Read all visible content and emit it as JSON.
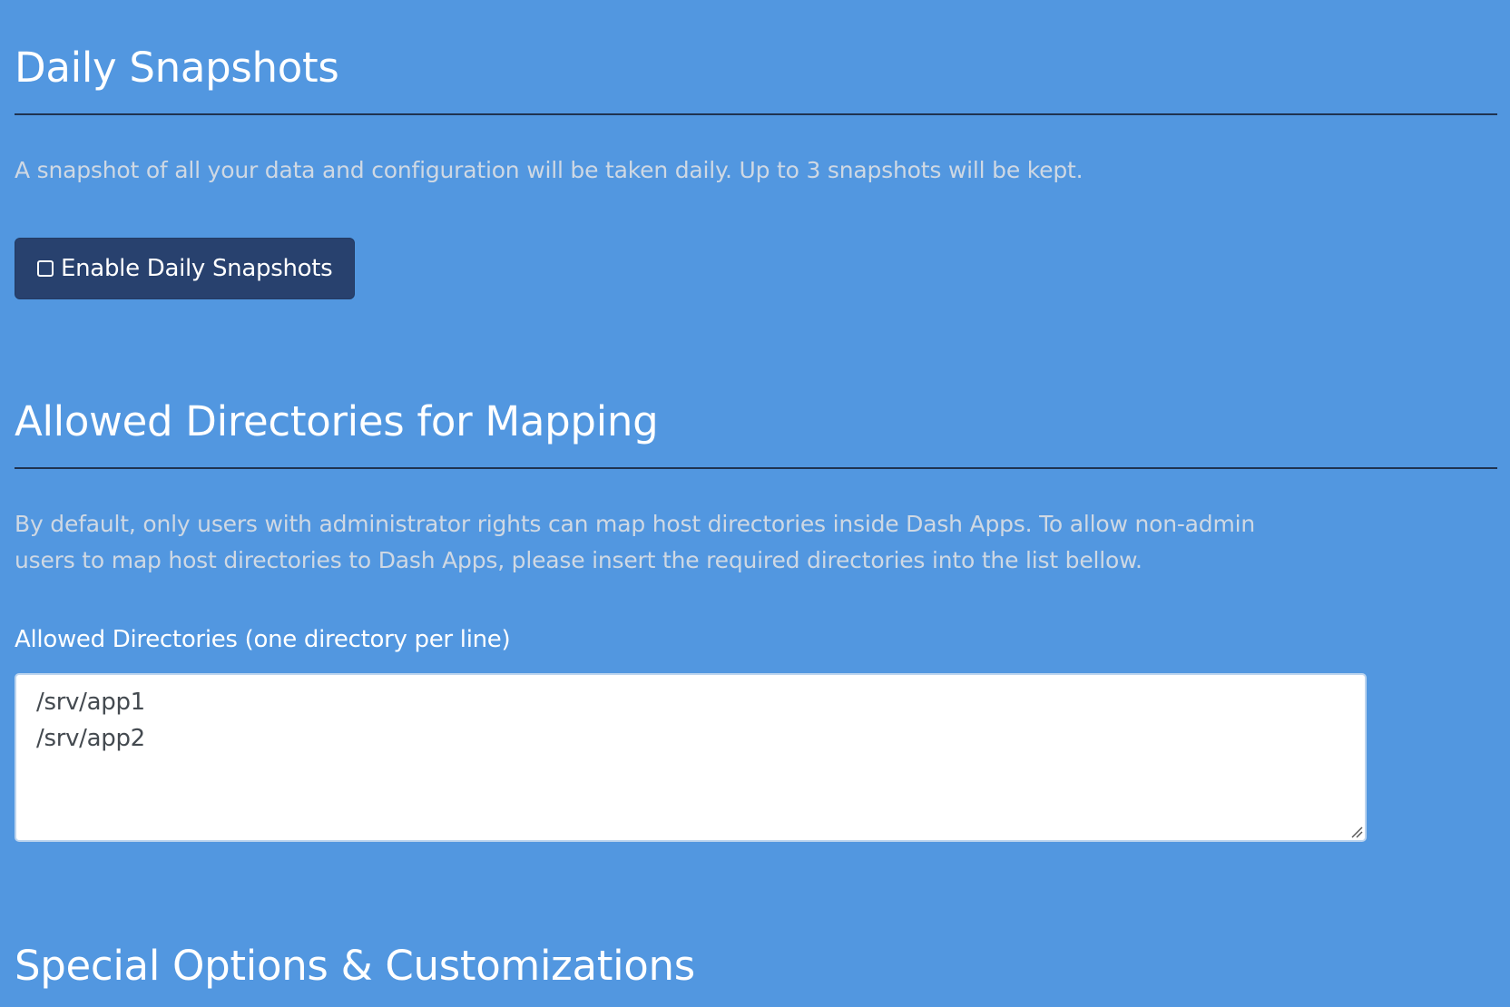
{
  "daily_snapshots": {
    "title": "Daily Snapshots",
    "description": "A snapshot of all your data and configuration will be taken daily. Up to 3 snapshots will be kept.",
    "enable_button_label": "Enable Daily Snapshots"
  },
  "allowed_directories": {
    "title": "Allowed Directories for Mapping",
    "description_line1": "By default, only users with administrator rights can map host directories inside Dash Apps. To allow non-admin",
    "description_line2": "users to map host directories to Dash Apps, please insert the required directories into the list bellow.",
    "field_label": "Allowed Directories (one directory per line)",
    "field_value": "/srv/app1\n/srv/app2"
  },
  "special_options": {
    "title": "Special Options & Customizations"
  },
  "colors": {
    "background": "#5297e0",
    "button": "#28416e",
    "divider": "#1f3350",
    "muted_text": "#cfd8e3"
  }
}
